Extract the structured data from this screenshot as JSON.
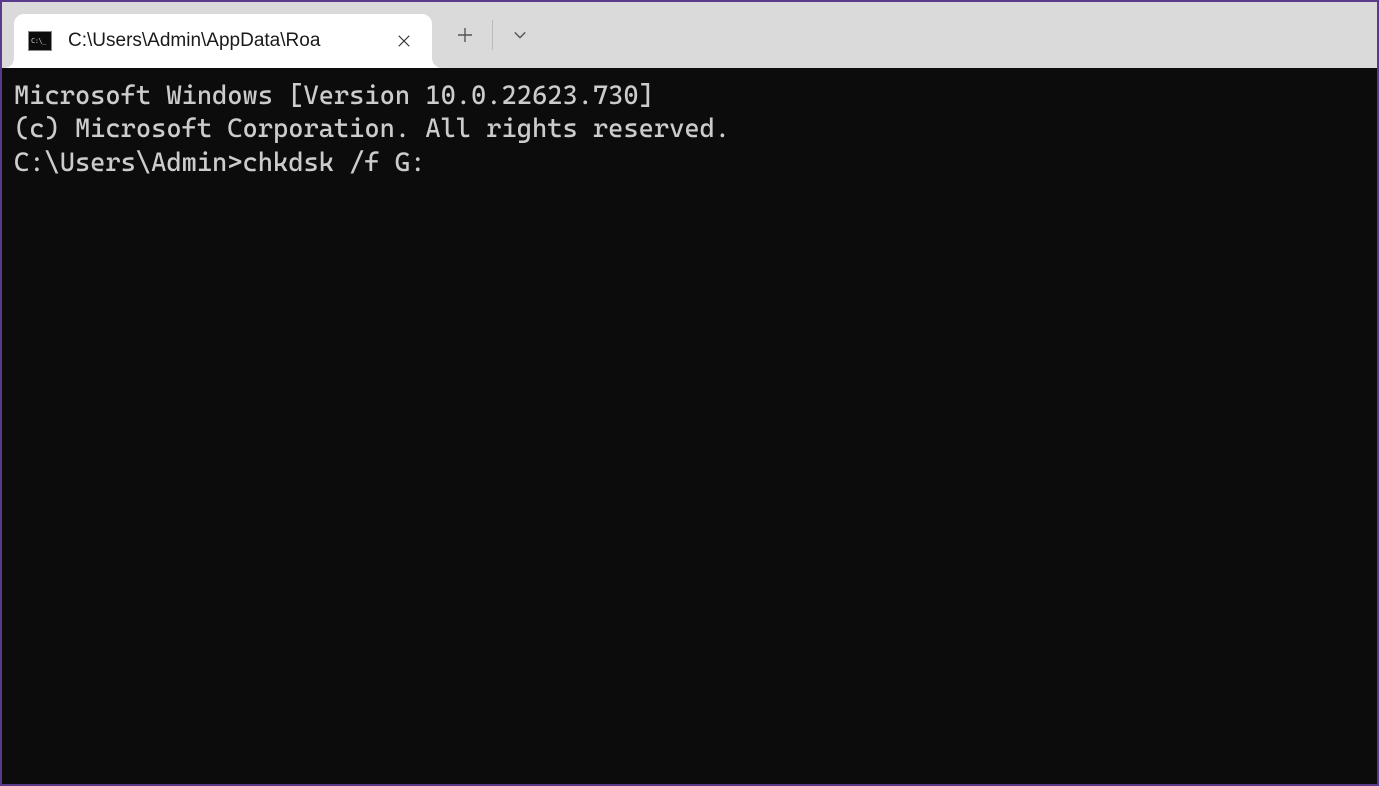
{
  "tab": {
    "title": "C:\\Users\\Admin\\AppData\\Roa",
    "icon_name": "cmd-icon"
  },
  "terminal": {
    "line1": "Microsoft Windows [Version 10.0.22623.730]",
    "line2": "(c) Microsoft Corporation. All rights reserved.",
    "blank": "",
    "prompt": "C:\\Users\\Admin>",
    "command": "chkdsk /f G:"
  }
}
